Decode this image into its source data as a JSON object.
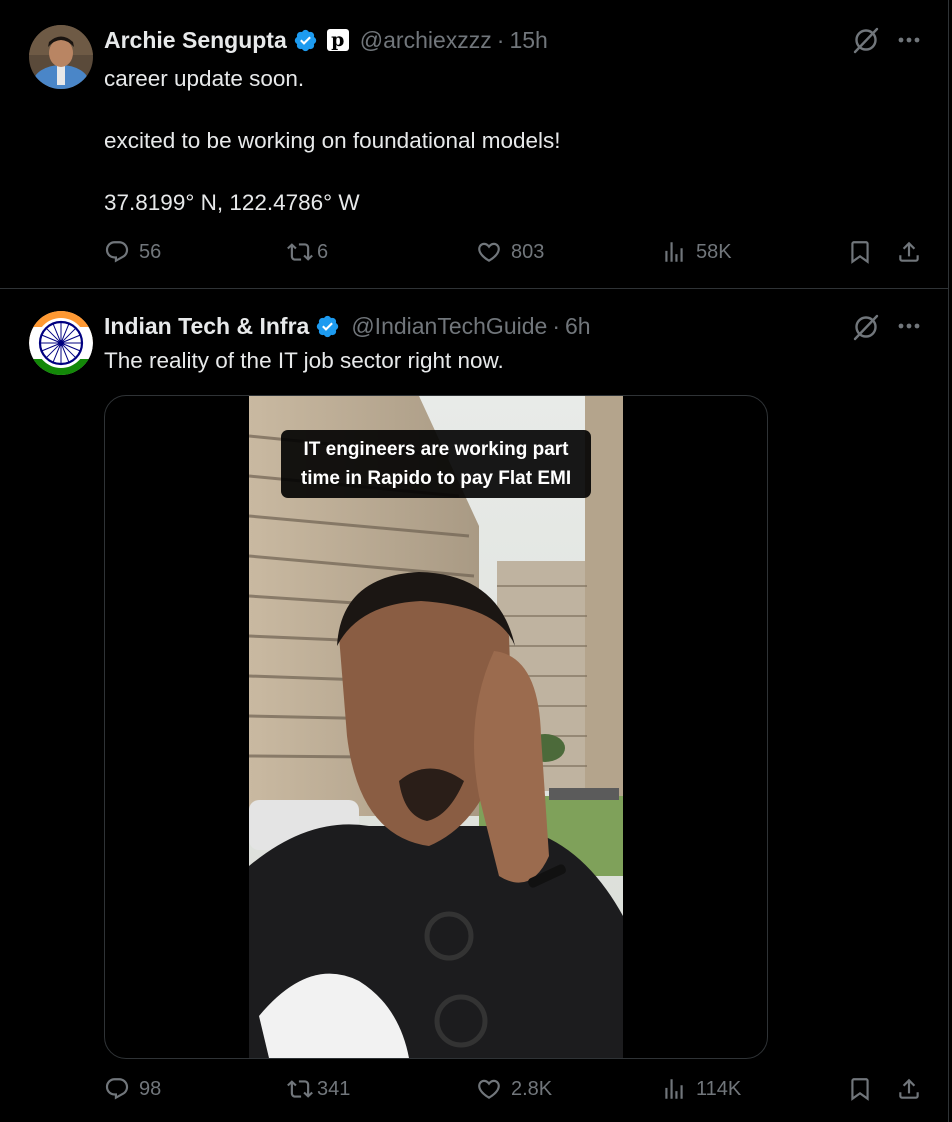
{
  "tweets": [
    {
      "author": {
        "name": "Archie Sengupta",
        "handle": "@archiexzzz",
        "verified": true,
        "affiliate_badge": "p"
      },
      "separator": "·",
      "time": "15h",
      "body": [
        "career update soon.",
        "excited to be working on foundational models!",
        "37.8199° N, 122.4786° W"
      ],
      "stats": {
        "replies": "56",
        "reposts": "6",
        "likes": "803",
        "views": "58K"
      }
    },
    {
      "author": {
        "name": "Indian Tech & Infra",
        "handle": "@IndianTechGuide",
        "verified": true
      },
      "separator": "·",
      "time": "6h",
      "body": [
        "The reality of the IT job sector right now."
      ],
      "media": {
        "caption": "IT engineers are working part time in Rapido to pay Flat EMI"
      },
      "stats": {
        "replies": "98",
        "reposts": "341",
        "likes": "2.8K",
        "views": "114K"
      }
    }
  ],
  "colors": {
    "background": "#000000",
    "text": "#e7e9ea",
    "secondary": "#71767b",
    "verified": "#1d9bf0",
    "divider": "#2f3336"
  },
  "icons": {
    "reply": "reply-icon",
    "repost": "repost-icon",
    "like": "heart-icon",
    "views": "views-icon",
    "bookmark": "bookmark-icon",
    "share": "share-icon",
    "grok": "grok-icon",
    "more": "more-icon"
  }
}
